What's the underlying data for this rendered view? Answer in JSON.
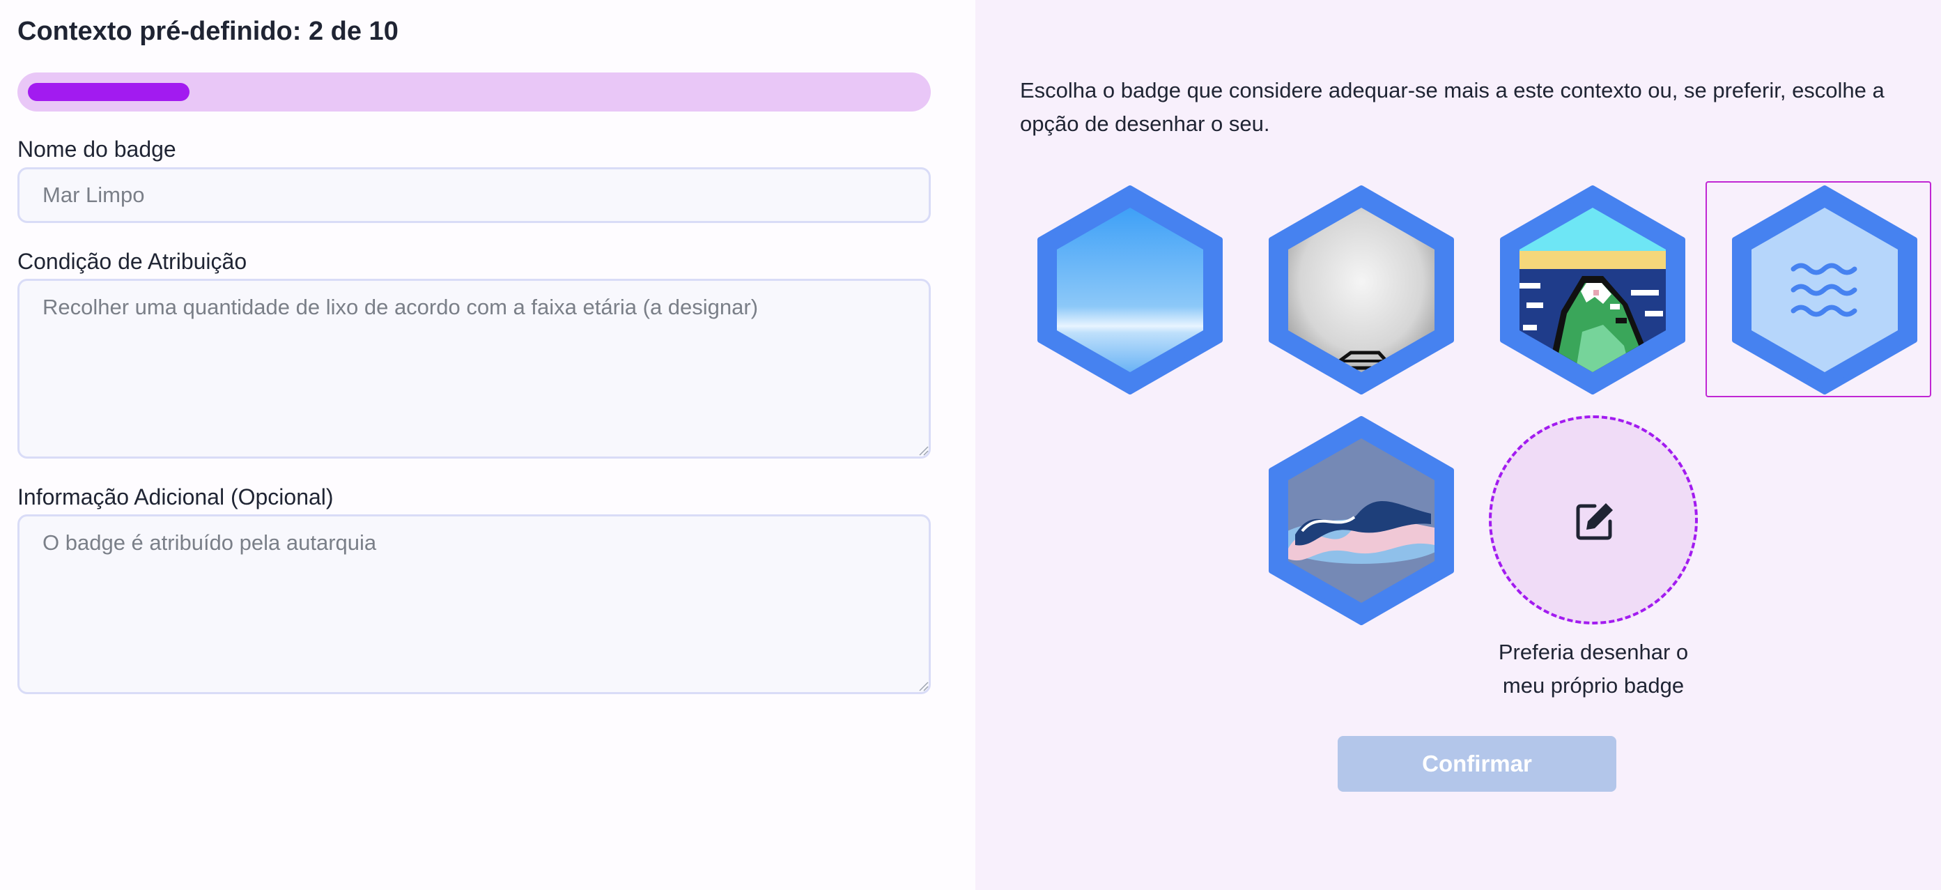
{
  "header": {
    "title": "Contexto pré-definido: 2 de 10"
  },
  "progress": {
    "current": 2,
    "total": 10,
    "fraction": 0.2
  },
  "form": {
    "name_label": "Nome do badge",
    "name_value": "Mar Limpo",
    "condition_label": "Condição de Atribuição",
    "condition_value": "Recolher uma quantidade de lixo de acordo com a faixa etária (a designar)",
    "info_label": "Informação Adicional (Opcional)",
    "info_value": "O badge é atribuído pela autarquia"
  },
  "badge_picker": {
    "instructions": "Escolha o badge que considere adequar-se mais a este contexto ou, se preferir, escolhe a opção de desenhar o seu.",
    "badges": [
      {
        "id": "sky",
        "icon": "sky-gradient-image",
        "selected": false
      },
      {
        "id": "mist",
        "icon": "grey-mist-image",
        "selected": false
      },
      {
        "id": "pixel-mountain",
        "icon": "pixel-mountain-image",
        "selected": false
      },
      {
        "id": "waves",
        "icon": "waves-icon",
        "selected": true
      },
      {
        "id": "wave-sculpture",
        "icon": "wave-shape-image",
        "selected": false
      }
    ],
    "draw_option_label": "Preferia desenhar o meu próprio badge",
    "draw_icon": "edit-icon"
  },
  "actions": {
    "confirm_label": "Confirmar",
    "confirm_enabled": false
  },
  "colors": {
    "accent": "#a21bf0",
    "hex_border": "#4682f0",
    "progress_track": "#e9c7f7",
    "confirm_disabled": "#b3c6ea",
    "right_panel_bg": "#f8f0fc"
  }
}
